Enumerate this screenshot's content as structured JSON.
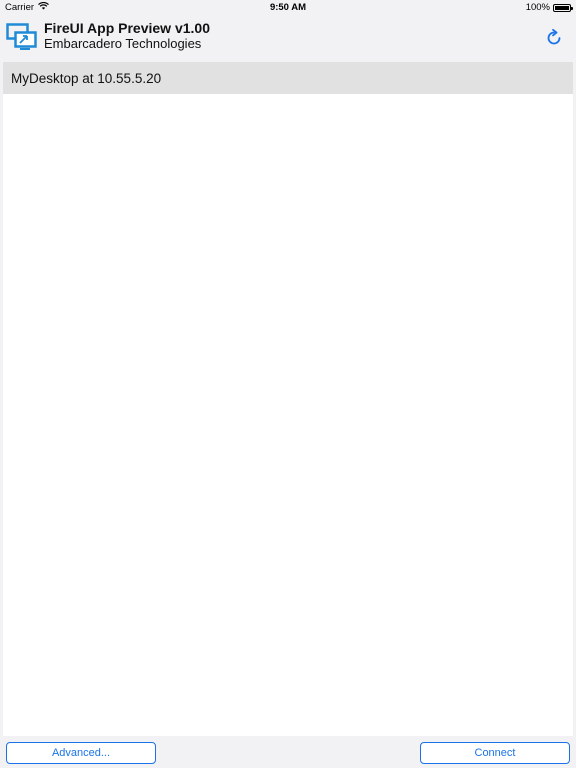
{
  "status_bar": {
    "carrier": "Carrier",
    "time": "9:50 AM",
    "battery_text": "100%",
    "battery_level": 1.0
  },
  "header": {
    "title": "FireUI App Preview v1.00",
    "subtitle": "Embarcadero Technologies",
    "logo_icon": "desktop-preview-icon",
    "refresh_icon": "refresh-icon"
  },
  "list": {
    "items": [
      {
        "label": "MyDesktop at 10.55.5.20"
      }
    ]
  },
  "toolbar": {
    "advanced_label": "Advanced...",
    "connect_label": "Connect"
  },
  "colors": {
    "accent": "#1a73e8",
    "logo_blue": "#1f8ad6",
    "selected_row": "#e1e1e2",
    "chrome_background": "#f2f2f4"
  }
}
